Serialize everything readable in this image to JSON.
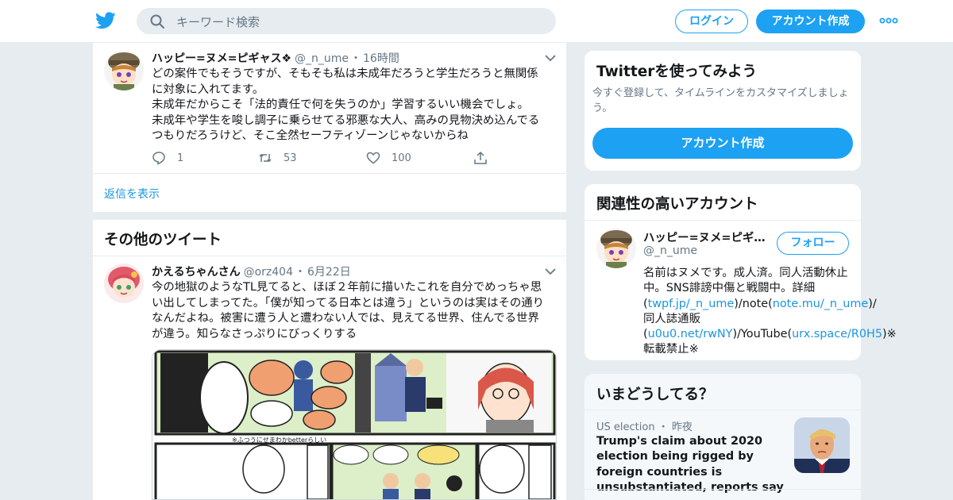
{
  "colors": {
    "brand": "#1da1f2",
    "link": "#1b95e0",
    "muted": "#657786",
    "background": "#e6ecf0"
  },
  "header": {
    "logo_icon": "twitter-bird-icon",
    "search_placeholder": "キーワード検索",
    "login_label": "ログイン",
    "signup_label": "アカウント作成",
    "more_icon": "more-dots-icon"
  },
  "main_tweet": {
    "name": "ハッピー=ヌメ=ピギャス❖",
    "handle": "@_n_ume",
    "time": "16時間",
    "lines": [
      "どの案件でもそうですが、そもそも私は未成年だろうと学生だろうと無関係に対象に入れてます。",
      "未成年だからこそ「法的責任で何を失うのか」学習するいい機会でしょ。",
      "未成年や学生を唆し調子に乗らせてる邪悪な大人、高みの見物決め込んでるつもりだろうけど、そこ全然セーフティゾーンじゃないからね"
    ],
    "replies": "1",
    "retweets": "53",
    "likes": "100"
  },
  "show_replies": "返信を表示",
  "more_tweets_title": "その他のツイート",
  "second_tweet": {
    "name": "かえるちゃんさん",
    "handle": "@orz404",
    "time": "6月22日",
    "text": "今の地獄のようなTL見てると、ほぼ２年前に描いたこれを自分でめっちゃ思い出してしまってた。「僕が知ってる日本とは違う」というのは実はその通りなんだよね。被害に遭う人と遭わない人では、見えてる世界、住んでる世界が違う。知らなさっぷりにびっくりする",
    "media_caption": "※ふつうにせまわかbetterらしい"
  },
  "sidebar": {
    "try": {
      "title": "Twitterを使ってみよう",
      "subtitle": "今すぐ登録して、タイムラインをカスタマイズしましょう。",
      "button": "アカウント作成"
    },
    "related": {
      "title": "関連性の高いアカウント",
      "name": "ハッピー=ヌメ=ピギャス❖",
      "handle": "@_n_ume",
      "follow": "フォロー",
      "bio_1": "名前はヌメです。成人済。同人活動休止中。SNS誹謗中傷と戦闘中。詳細(",
      "link_1": "twpf.jp/_n_ume",
      "bio_2": ")/note(",
      "link_2": "note.mu/_n_ume",
      "bio_3": ")/同人誌通販(",
      "link_3": "u0u0.net/rwNY",
      "bio_4": ")/YouTube(",
      "link_4": "urx.space/R0H5",
      "bio_5": ")※転載禁止※"
    },
    "trends": {
      "title": "いまどうしてる？",
      "category": "US election",
      "when": "昨夜",
      "headline": "Trump's claim about 2020 election being rigged by foreign countries is unsubstantiated, reports say"
    }
  }
}
